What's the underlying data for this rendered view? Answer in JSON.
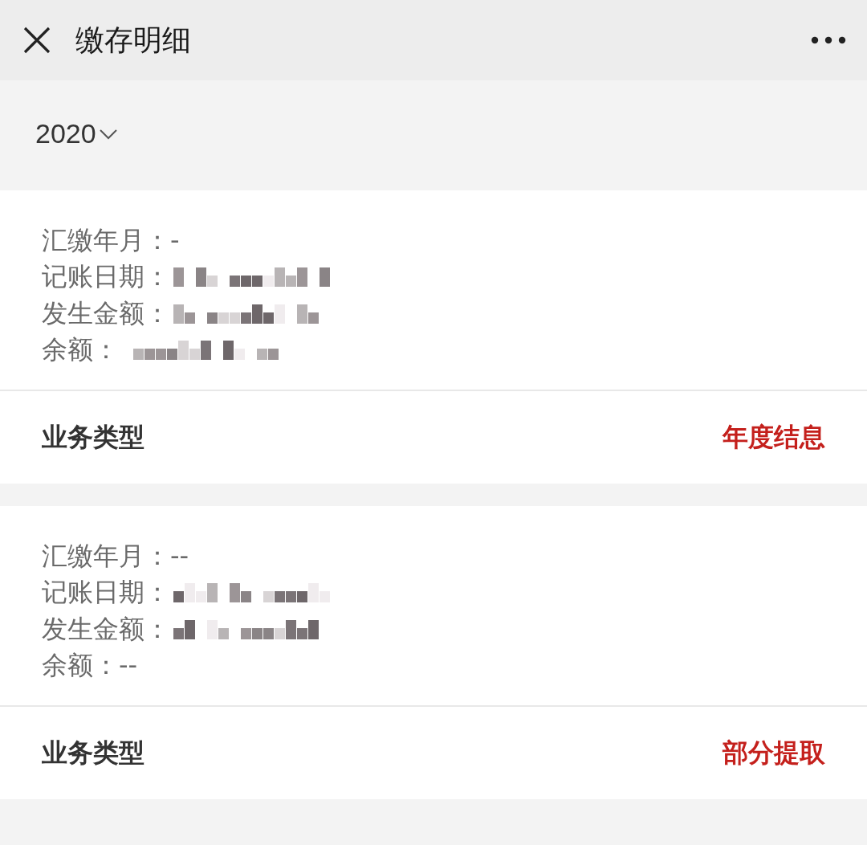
{
  "header": {
    "title": "缴存明细"
  },
  "year_picker": {
    "value": "2020"
  },
  "records": [
    {
      "lines": [
        {
          "text": "汇缴年月：-",
          "redacted": false
        },
        {
          "text": "记账日期：",
          "redacted": true
        },
        {
          "text": "发生金额：",
          "redacted": true
        },
        {
          "text": "余额：",
          "redacted": true
        }
      ],
      "type_label": "业务类型",
      "type_value": "年度结息"
    },
    {
      "lines": [
        {
          "text": "汇缴年月：--",
          "redacted": false
        },
        {
          "text": "记账日期：",
          "redacted": true
        },
        {
          "text": "发生金额：",
          "redacted": true
        },
        {
          "text": "余额：--",
          "redacted": false
        }
      ],
      "type_label": "业务类型",
      "type_value": "部分提取"
    }
  ]
}
